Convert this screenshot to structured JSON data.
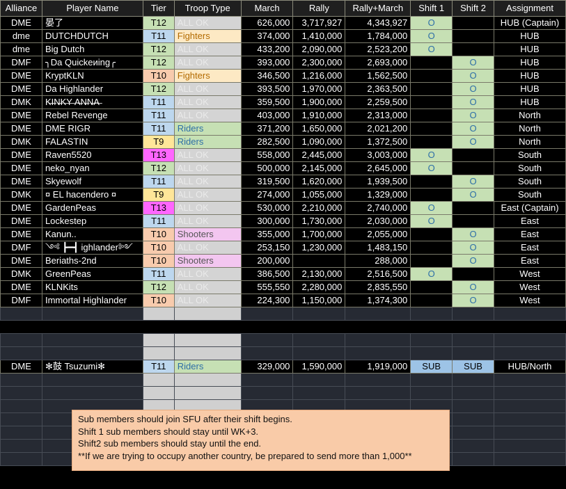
{
  "colors": {
    "tier": {
      "T9": "#ffe699",
      "T10": "#f8cbad",
      "T11": "#bdd7ee",
      "T12": "#c6e0b4",
      "T13": "#ff66ff"
    },
    "shift_on": "#c6e0b4",
    "shift_sub": "#9dc3e6",
    "note_bg": "#f9cba8"
  },
  "headers": [
    "Alliance",
    "Player Name",
    "Tier",
    "Troop Type",
    "March",
    "Rally",
    "Rally+March",
    "Shift 1",
    "Shift 2",
    "Assignment"
  ],
  "rows": [
    {
      "alliance": "DME",
      "name": "晏了",
      "tier": "T12",
      "troop": "ALL OK",
      "troop_class": "troop",
      "march": "626,000",
      "rally": "3,717,927",
      "total": "4,343,927",
      "shift1": "O",
      "shift2": "",
      "assignment": "HUB (Captain)"
    },
    {
      "alliance": "dme",
      "name": "DUTCHDUTCH",
      "tier": "T11",
      "troop": "Fighters",
      "troop_class": "troop-fighters",
      "march": "374,000",
      "rally": "1,410,000",
      "total": "1,784,000",
      "shift1": "O",
      "shift2": "",
      "assignment": "HUB"
    },
    {
      "alliance": "dme",
      "name": "Big Dutch",
      "tier": "T12",
      "troop": "ALL OK",
      "troop_class": "troop",
      "march": "433,200",
      "rally": "2,090,000",
      "total": "2,523,200",
      "shift1": "O",
      "shift2": "",
      "assignment": "HUB"
    },
    {
      "alliance": "DMF",
      "name": "╮Da Quickeиing╭",
      "tier": "T12",
      "troop": "ALL OK",
      "troop_class": "troop",
      "march": "393,000",
      "rally": "2,300,000",
      "total": "2,693,000",
      "shift1": "",
      "shift2": "O",
      "assignment": "HUB"
    },
    {
      "alliance": "DME",
      "name": "KryptKLN",
      "tier": "T10",
      "troop": "Fighters",
      "troop_class": "troop-fighters",
      "march": "346,500",
      "rally": "1,216,000",
      "total": "1,562,500",
      "shift1": "",
      "shift2": "O",
      "assignment": "HUB"
    },
    {
      "alliance": "DME",
      "name": "Da Highlander",
      "tier": "T12",
      "troop": "ALL OK",
      "troop_class": "troop",
      "march": "393,500",
      "rally": "1,970,000",
      "total": "2,363,500",
      "shift1": "",
      "shift2": "O",
      "assignment": "HUB"
    },
    {
      "alliance": "DMK",
      "name": "K̶I̶N̶K̶Y̶ A̶N̶N̶A̶",
      "tier": "T11",
      "troop": "ALL OK",
      "troop_class": "troop",
      "march": "359,500",
      "rally": "1,900,000",
      "total": "2,259,500",
      "shift1": "",
      "shift2": "O",
      "assignment": "HUB"
    },
    {
      "alliance": "DME",
      "name": "Rebel Revenge",
      "tier": "T11",
      "troop": "ALL OK",
      "troop_class": "troop",
      "march": "403,000",
      "rally": "1,910,000",
      "total": "2,313,000",
      "shift1": "",
      "shift2": "O",
      "assignment": "North"
    },
    {
      "alliance": "DME",
      "name": "DME RIGR",
      "tier": "T11",
      "troop": "Riders",
      "troop_class": "troop-riders",
      "march": "371,200",
      "rally": "1,650,000",
      "total": "2,021,200",
      "shift1": "",
      "shift2": "O",
      "assignment": "North"
    },
    {
      "alliance": "DMK",
      "name": "FALASTIN",
      "tier": "T9",
      "troop": "Riders",
      "troop_class": "troop-riders",
      "march": "282,500",
      "rally": "1,090,000",
      "total": "1,372,500",
      "shift1": "",
      "shift2": "O",
      "assignment": "North"
    },
    {
      "alliance": "DME",
      "name": "Raven5520",
      "tier": "T13",
      "troop": "ALL OK",
      "troop_class": "troop",
      "march": "558,000",
      "rally": "2,445,000",
      "total": "3,003,000",
      "shift1": "O",
      "shift2": "",
      "assignment": "South"
    },
    {
      "alliance": "DME",
      "name": "neko_nyan",
      "tier": "T12",
      "troop": "ALL OK",
      "troop_class": "troop",
      "march": "500,000",
      "rally": "2,145,000",
      "total": "2,645,000",
      "shift1": "O",
      "shift2": "",
      "assignment": "South"
    },
    {
      "alliance": "DME",
      "name": "Skyewolf",
      "tier": "T11",
      "troop": "ALL OK",
      "troop_class": "troop",
      "march": "319,500",
      "rally": "1,620,000",
      "total": "1,939,500",
      "shift1": "",
      "shift2": "O",
      "assignment": "South"
    },
    {
      "alliance": "DMK",
      "name": "¤ EL hacendero ¤",
      "tier": "T9",
      "troop": "ALL OK",
      "troop_class": "troop",
      "march": "274,000",
      "rally": "1,055,000",
      "total": "1,329,000",
      "shift1": "",
      "shift2": "O",
      "assignment": "South"
    },
    {
      "alliance": "DME",
      "name": "GardenPeas",
      "tier": "T13",
      "troop": "ALL OK",
      "troop_class": "troop",
      "march": "530,000",
      "rally": "2,210,000",
      "total": "2,740,000",
      "shift1": "O",
      "shift2": "",
      "assignment": "East (Captain)"
    },
    {
      "alliance": "DME",
      "name": "Lockestep",
      "tier": "T11",
      "troop": "ALL OK",
      "troop_class": "troop",
      "march": "300,000",
      "rally": "1,730,000",
      "total": "2,030,000",
      "shift1": "O",
      "shift2": "",
      "assignment": "East"
    },
    {
      "alliance": "DME",
      "name": "Kanun..",
      "tier": "T10",
      "troop": "Shooters",
      "troop_class": "troop-shooters",
      "march": "355,000",
      "rally": "1,700,000",
      "total": "2,055,000",
      "shift1": "",
      "shift2": "O",
      "assignment": "East"
    },
    {
      "alliance": "DMF",
      "name": "༺ ┣━┫ ighlander༻",
      "tier": "T10",
      "troop": "ALL OK",
      "troop_class": "troop",
      "march": "253,150",
      "rally": "1,230,000",
      "total": "1,483,150",
      "shift1": "",
      "shift2": "O",
      "assignment": "East"
    },
    {
      "alliance": "DME",
      "name": "Beriaths-2nd",
      "tier": "T10",
      "troop": "Shooters",
      "troop_class": "troop-shooters",
      "march": "200,000",
      "rally": "",
      "total": "288,000",
      "shift1": "",
      "shift2": "O",
      "assignment": "East"
    },
    {
      "alliance": "DMK",
      "name": "GreenPeas",
      "tier": "T11",
      "troop": "ALL OK",
      "troop_class": "troop",
      "march": "386,500",
      "rally": "2,130,000",
      "total": "2,516,500",
      "shift1": "O",
      "shift2": "",
      "assignment": "West"
    },
    {
      "alliance": "DME",
      "name": "KLNKits",
      "tier": "T12",
      "troop": "ALL OK",
      "troop_class": "troop",
      "march": "555,550",
      "rally": "2,280,000",
      "total": "2,835,550",
      "shift1": "",
      "shift2": "O",
      "assignment": "West"
    },
    {
      "alliance": "DMF",
      "name": "Immortal Highlander",
      "tier": "T10",
      "troop": "ALL OK",
      "troop_class": "troop",
      "march": "224,300",
      "rally": "1,150,000",
      "total": "1,374,300",
      "shift1": "",
      "shift2": "O",
      "assignment": "West"
    }
  ],
  "sub_row": {
    "alliance": "DME",
    "name": "✻鼓 Tsuzumi✻",
    "tier": "T11",
    "troop": "Riders",
    "march": "329,000",
    "rally": "1,590,000",
    "total": "1,919,000",
    "shift1": "SUB",
    "shift2": "SUB",
    "assignment": "HUB/North"
  },
  "note": {
    "line1": "Sub members should join SFU after their shift begins.",
    "line2": "Shift 1 sub members should stay until WK+3.",
    "line3": "Shift2 sub members should stay until the end.",
    "line4": "**If we are trying to occupy another country, be prepared to send more than 1,000**"
  }
}
